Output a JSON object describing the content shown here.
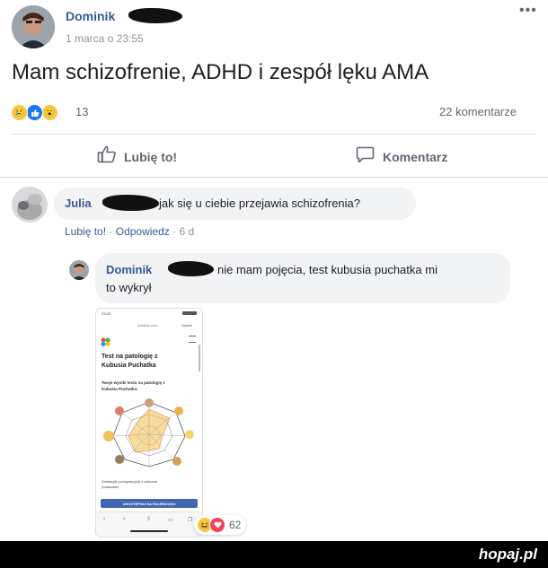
{
  "post": {
    "author_name": "Dominik",
    "timestamp": "1 marca o 23:55",
    "more_icon": "more-icon",
    "text": "Mam schizofrenie, ADHD i zespół lęku AMA",
    "reaction_count": "13",
    "comment_count": "22 komentarze",
    "like_label": "Lubię to!",
    "comment_label": "Komentarz"
  },
  "comments": {
    "c1": {
      "author": "Julia",
      "text": "jak się u ciebie przejawia schizofrenia?",
      "like": "Lubię to!",
      "reply": "Odpowiedz",
      "time": "6 d"
    },
    "c2": {
      "author": "Dominik",
      "text_line1": "nie mam pojęcia, test kubusia puchatka mi",
      "text_line2": "to wykrył",
      "reaction_count": "62"
    }
  },
  "phone": {
    "status_time": "23:03",
    "url": "Ankieta.com",
    "share_menu": "Spisek",
    "title_line1": "Test na patologię z",
    "title_line2": "Kubusia Puchatka",
    "result_line1": "Twoje wyniki testu na patologię z",
    "result_line2": "Kubusia Puchatka:",
    "footer_line1": "Zestaw(ił) powiązany(ej) z wieloma",
    "footer_line2": "postaciami.",
    "share_button": "UDOSTĘPNIJ NA FACEBOOKU"
  },
  "watermark": "hopaj.pl",
  "colors": {
    "link": "#385898",
    "muted": "#90949c",
    "bubble": "#f2f3f5",
    "facebook_blue": "#4267b2"
  }
}
